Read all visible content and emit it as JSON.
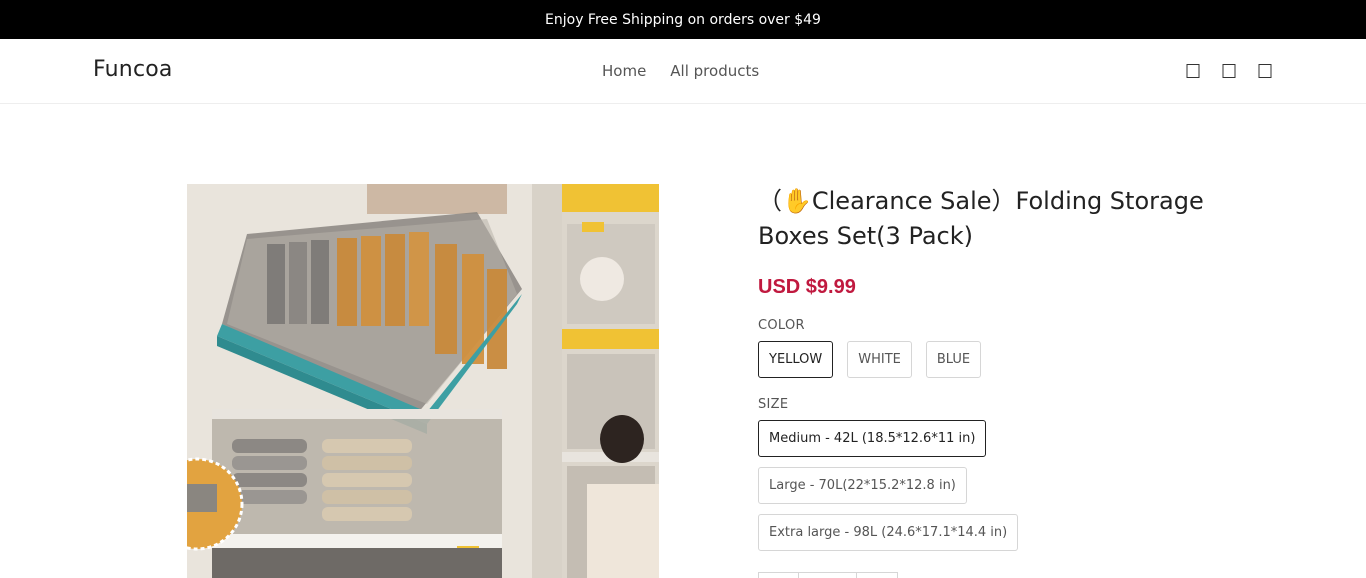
{
  "announcement": {
    "text": "Enjoy Free Shipping on orders over $49"
  },
  "header": {
    "logo": "Funcoa",
    "nav": [
      {
        "label": "Home"
      },
      {
        "label": "All products"
      }
    ],
    "icons": [
      "search-icon",
      "account-icon",
      "cart-icon"
    ]
  },
  "product": {
    "title": "（✋Clearance Sale）Folding Storage Boxes Set(3 Pack)",
    "price": "USD $9.99",
    "color": {
      "label": "COLOR",
      "options": [
        "YELLOW",
        "WHITE",
        "BLUE"
      ],
      "selected": "YELLOW"
    },
    "size": {
      "label": "SIZE",
      "options": [
        "Medium - 42L (18.5*12.6*11 in)",
        "Large - 70L(22*15.2*12.8 in)",
        "Extra large - 98L (24.6*17.1*14.4 in)"
      ],
      "selected": "Medium - 42L (18.5*12.6*11 in)"
    }
  },
  "colors": {
    "announcement_bg": "#000000",
    "price": "#c0193f",
    "box_teal": "#3d9fa3",
    "box_yellow": "#f0c234",
    "fabric_orange": "#c98a3c"
  }
}
